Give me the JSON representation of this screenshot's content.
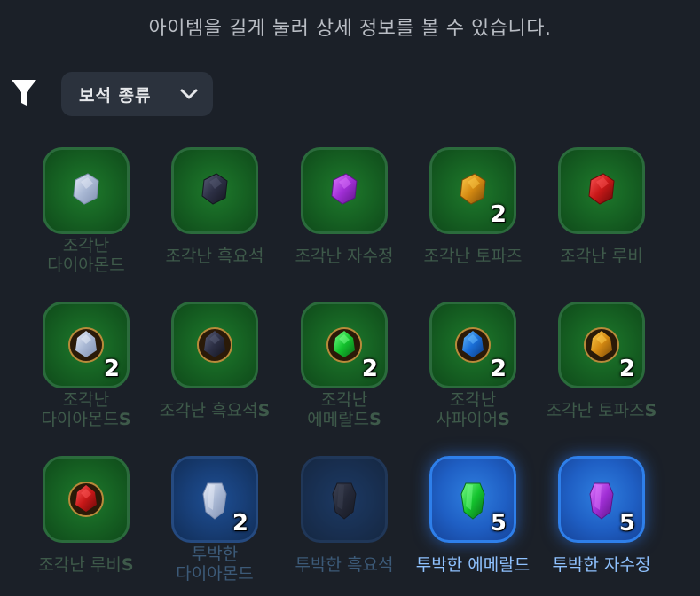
{
  "hint": "아이템을 길게 눌러 상세 정보를 볼 수 있습니다.",
  "filter": {
    "icon": "filter-icon",
    "dropdown_label": "보석 종류"
  },
  "colors": {
    "background": "#1b2028",
    "green_tile": "#176524",
    "blue_tile": "#183f78",
    "active_blue": "#2e7fea",
    "active_label": "#8fc2ff"
  },
  "items": [
    {
      "lines": [
        "조각난",
        "다이아몬드"
      ],
      "suffix": "",
      "qty": "",
      "tile": "green",
      "gem": "diamond",
      "style": "rough"
    },
    {
      "lines": [
        "조각난 흑요석"
      ],
      "suffix": "",
      "qty": "",
      "tile": "green",
      "gem": "obsidian",
      "style": "rough"
    },
    {
      "lines": [
        "조각난 자수정"
      ],
      "suffix": "",
      "qty": "",
      "tile": "green",
      "gem": "amethyst",
      "style": "rough"
    },
    {
      "lines": [
        "조각난 토파즈"
      ],
      "suffix": "",
      "qty": "2",
      "tile": "green",
      "gem": "topaz",
      "style": "rough"
    },
    {
      "lines": [
        "조각난 루비"
      ],
      "suffix": "",
      "qty": "",
      "tile": "green",
      "gem": "ruby",
      "style": "rough"
    },
    {
      "lines": [
        "조각난",
        "다이아몬드"
      ],
      "suffix": "S",
      "qty": "2",
      "tile": "green",
      "gem": "diamond",
      "style": "set"
    },
    {
      "lines": [
        "조각난 흑요석"
      ],
      "suffix": "S",
      "qty": "",
      "tile": "green",
      "gem": "obsidian",
      "style": "set"
    },
    {
      "lines": [
        "조각난",
        "에메랄드"
      ],
      "suffix": "S",
      "qty": "2",
      "tile": "green",
      "gem": "emerald",
      "style": "set"
    },
    {
      "lines": [
        "조각난",
        "사파이어"
      ],
      "suffix": "S",
      "qty": "2",
      "tile": "green",
      "gem": "sapphire",
      "style": "set"
    },
    {
      "lines": [
        "조각난 토파즈"
      ],
      "suffix": "S",
      "qty": "2",
      "tile": "green",
      "gem": "topaz",
      "style": "set"
    },
    {
      "lines": [
        "조각난 루비"
      ],
      "suffix": "S",
      "qty": "",
      "tile": "green",
      "gem": "ruby",
      "style": "set"
    },
    {
      "lines": [
        "투박한",
        "다이아몬드"
      ],
      "suffix": "",
      "qty": "2",
      "tile": "blue",
      "gem": "diamond",
      "style": "crystal"
    },
    {
      "lines": [
        "투박한 흑요석"
      ],
      "suffix": "",
      "qty": "",
      "tile": "blue",
      "gem": "obsidian",
      "style": "crystal"
    },
    {
      "lines": [
        "투박한 에메랄드"
      ],
      "suffix": "",
      "qty": "5",
      "tile": "bright",
      "gem": "emerald",
      "style": "crystal"
    },
    {
      "lines": [
        "투박한 자수정"
      ],
      "suffix": "",
      "qty": "5",
      "tile": "bright",
      "gem": "amethyst",
      "style": "crystal"
    }
  ]
}
